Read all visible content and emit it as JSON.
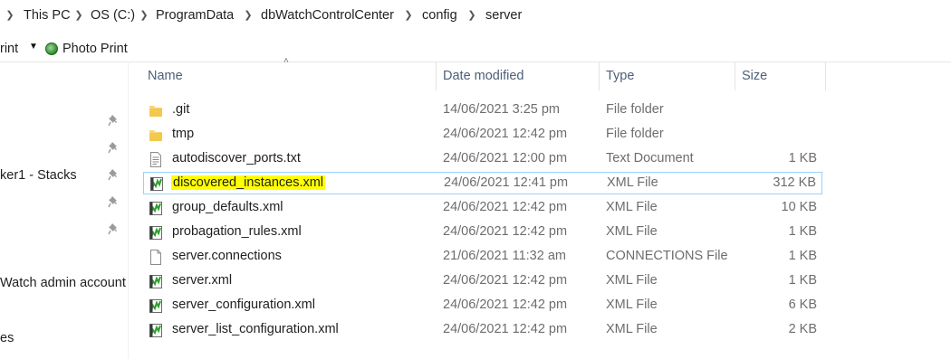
{
  "breadcrumb": {
    "items": [
      "This PC",
      "OS (C:)",
      "ProgramData",
      "dbWatchControlCenter",
      "config",
      "server"
    ]
  },
  "toolbar": {
    "print_label": "rint",
    "photo_print_label": "Photo Print"
  },
  "nav": {
    "items": [
      "ker1 - Stacks",
      "Watch admin account",
      "es"
    ]
  },
  "columns": {
    "name": "Name",
    "date": "Date modified",
    "type": "Type",
    "size": "Size"
  },
  "files": [
    {
      "name": ".git",
      "date": "14/06/2021 3:25 pm",
      "type": "File folder",
      "size": "",
      "icon": "folder-icon"
    },
    {
      "name": "tmp",
      "date": "24/06/2021 12:42 pm",
      "type": "File folder",
      "size": "",
      "icon": "folder-icon"
    },
    {
      "name": "autodiscover_ports.txt",
      "date": "24/06/2021 12:00 pm",
      "type": "Text Document",
      "size": "1 KB",
      "icon": "text-file-icon"
    },
    {
      "name": "discovered_instances.xml",
      "date": "24/06/2021 12:41 pm",
      "type": "XML File",
      "size": "312 KB",
      "icon": "xml-file-icon"
    },
    {
      "name": "group_defaults.xml",
      "date": "24/06/2021 12:42 pm",
      "type": "XML File",
      "size": "10 KB",
      "icon": "xml-file-icon"
    },
    {
      "name": "probagation_rules.xml",
      "date": "24/06/2021 12:42 pm",
      "type": "XML File",
      "size": "1 KB",
      "icon": "xml-file-icon"
    },
    {
      "name": "server.connections",
      "date": "21/06/2021 11:32 am",
      "type": "CONNECTIONS File",
      "size": "1 KB",
      "icon": "blank-file-icon"
    },
    {
      "name": "server.xml",
      "date": "24/06/2021 12:42 pm",
      "type": "XML File",
      "size": "1 KB",
      "icon": "xml-file-icon"
    },
    {
      "name": "server_configuration.xml",
      "date": "24/06/2021 12:42 pm",
      "type": "XML File",
      "size": "6 KB",
      "icon": "xml-file-icon"
    },
    {
      "name": "server_list_configuration.xml",
      "date": "24/06/2021 12:42 pm",
      "type": "XML File",
      "size": "2 KB",
      "icon": "xml-file-icon"
    }
  ],
  "colors": {
    "highlight": "#ffff00",
    "focus_border": "#99d1ff",
    "header_text": "#4c607a",
    "folder": "#f8d775"
  }
}
